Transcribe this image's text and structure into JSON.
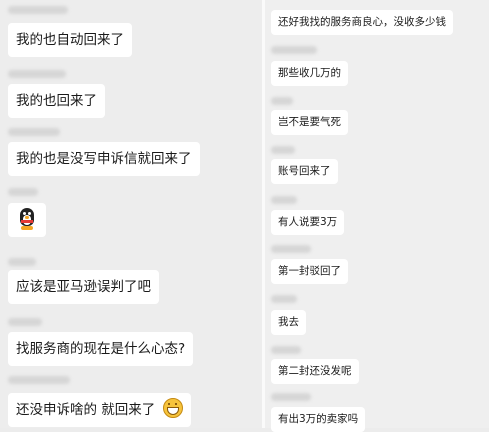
{
  "left_chat": {
    "messages": [
      {
        "text": "我的也自动回来了"
      },
      {
        "text": "我的也回来了"
      },
      {
        "text": "我的也是没写申诉信就回来了"
      },
      {
        "sticker": "qq-penguin-icon"
      },
      {
        "text": "应该是亚马逊误判了吧"
      },
      {
        "text": "找服务商的现在是什么心态?"
      },
      {
        "text": "还没申诉啥的 就回来了",
        "emoji": "grinning-face-icon"
      }
    ]
  },
  "right_chat": {
    "messages": [
      {
        "text": "还好我找的服务商良心，没收多少钱"
      },
      {
        "text": "那些收几万的"
      },
      {
        "text": "岂不是要气死"
      },
      {
        "text": "账号回来了"
      },
      {
        "text": "有人说要3万"
      },
      {
        "text": "第一封驳回了"
      },
      {
        "text": "我去"
      },
      {
        "text": "第二封还没发呢"
      },
      {
        "text": "有出3万的卖家吗"
      }
    ]
  },
  "colors": {
    "background": "#ededed",
    "bubble": "#ffffff",
    "text": "#1a1a1a"
  }
}
